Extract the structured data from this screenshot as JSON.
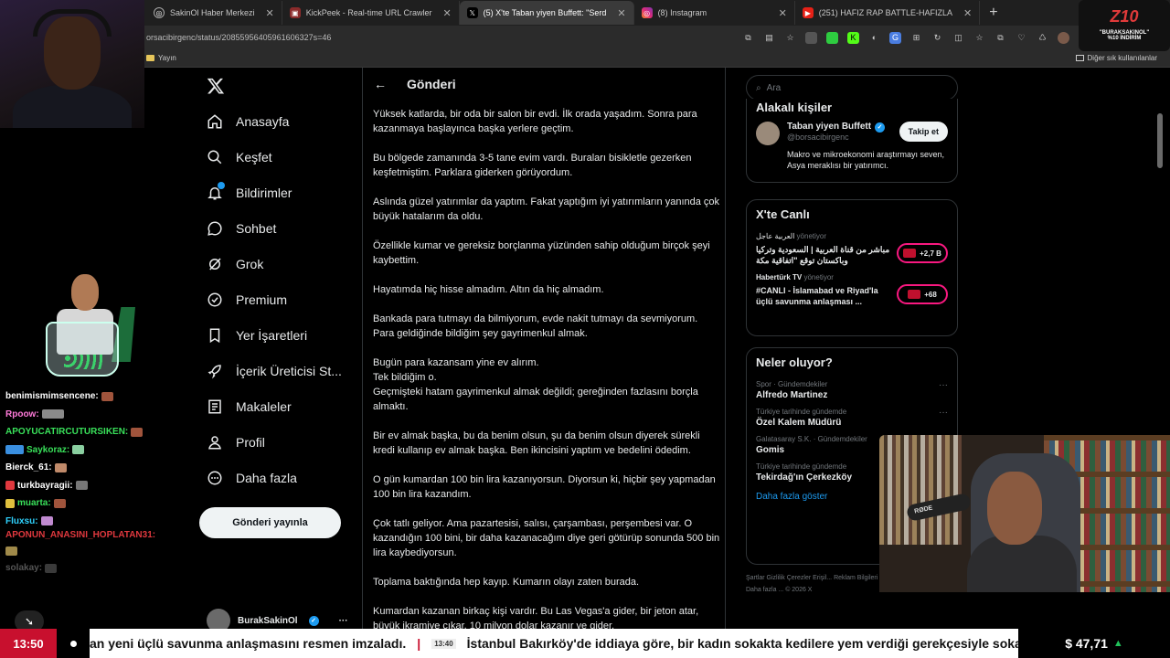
{
  "browser": {
    "tabs": [
      {
        "label": "SakinOl Haber Merkezi",
        "icon": "globe-icon",
        "active": false
      },
      {
        "label": "KickPeek - Real-time URL Crawler",
        "icon": "kickpeek-icon",
        "active": false
      },
      {
        "label": "(5) X'te Taban yiyen Buffett: \"Serd",
        "icon": "x-icon",
        "active": true
      },
      {
        "label": "(8) Instagram",
        "icon": "instagram-icon",
        "active": false
      },
      {
        "label": "(251) HAFIZ RAP BATTLE-HAFIZLA",
        "icon": "youtube-icon",
        "active": false
      }
    ],
    "url": "orsacibirgenc/status/20855956405961606327s=46",
    "bookmark": "Yayın",
    "other_bookmarks": "Diğer sık kullanılanlar"
  },
  "promo": {
    "logo": "Z10",
    "line1": "\"BURAKSAKINOL\"",
    "line2": "%10 İNDİRİM"
  },
  "chat": [
    {
      "user": "benimismimsencene:",
      "color": "#ffffff"
    },
    {
      "user": "Rpoow:",
      "color": "#ff7ad9"
    },
    {
      "user": "APOYUCATIRCUTURSIKEN:",
      "color": "#39e05a"
    },
    {
      "user": "Saykoraz:",
      "color": "#39e05a"
    },
    {
      "user": "Bierck_61:",
      "color": "#ffffff"
    },
    {
      "user": "turkbayragii:",
      "color": "#ffffff"
    },
    {
      "user": "muarta:",
      "color": "#39e05a"
    },
    {
      "user": "Fluxsu:",
      "color": "#2fd3ff"
    },
    {
      "user": "APONUN_ANASINI_HOPLATAN31:",
      "color": "#e0383e"
    },
    {
      "user": "solakay:",
      "color": "#555555"
    }
  ],
  "nav": {
    "items": [
      {
        "label": "Anasayfa",
        "icon": "home-icon"
      },
      {
        "label": "Keşfet",
        "icon": "search-icon"
      },
      {
        "label": "Bildirimler",
        "icon": "bell-icon"
      },
      {
        "label": "Sohbet",
        "icon": "chat-icon"
      },
      {
        "label": "Grok",
        "icon": "grok-icon"
      },
      {
        "label": "Premium",
        "icon": "premium-icon"
      },
      {
        "label": "Yer İşaretleri",
        "icon": "bookmark-icon"
      },
      {
        "label": "İçerik Üreticisi St...",
        "icon": "rocket-icon"
      },
      {
        "label": "Makaleler",
        "icon": "article-icon"
      },
      {
        "label": "Profil",
        "icon": "person-icon"
      },
      {
        "label": "Daha fazla",
        "icon": "more-icon"
      }
    ],
    "post_button": "Gönderi yayınla",
    "account_name": "BurakSakinOl"
  },
  "main": {
    "header": "Gönderi",
    "paragraphs": [
      "Yüksek katlarda, bir oda bir salon bir evdi. İlk orada yaşadım. Sonra para kazanmaya başlayınca başka yerlere geçtim.",
      "Bu bölgede zamanında 3-5 tane evim vardı. Buraları bisikletle gezerken keşfetmiştim. Parklara giderken görüyordum.",
      "Aslında güzel yatırımlar da yaptım. Fakat yaptığım iyi yatırımların yanında çok büyük hatalarım da oldu.",
      "Özellikle kumar ve gereksiz borçlanma yüzünden sahip olduğum birçok şeyi kaybettim.",
      "Hayatımda hiç hisse almadım. Altın da hiç almadım.",
      "Bankada para tutmayı da bilmiyorum, evde nakit tutmayı da sevmiyorum. Para geldiğinde bildiğim şey gayrimenkul almak.",
      "Bugün para kazansam yine ev alırım.\nTek bildiğim o.\nGeçmişteki hatam gayrimenkul almak değildi; gereğinden fazlasını borçla almaktı.",
      "Bir ev almak başka, bu da benim olsun, şu da benim olsun diyerek sürekli kredi kullanıp ev almak başka. Ben ikincisini yaptım ve bedelini ödedim.",
      "O gün kumardan 100 bin lira kazanıyorsun. Diyorsun ki, hiçbir şey yapmadan 100 bin lira kazandım.",
      "Çok tatlı geliyor. Ama pazartesisi, salısı, çarşambası, perşembesi var. O kazandığın 100 bini, bir daha kazanacağım diye geri götürüp sonunda 500 bin lira kaybediyorsun.",
      "Toplama baktığında hep kayıp. Kumarın olayı zaten burada.",
      "Kumardan kazanan birkaç kişi vardır. Bu Las Vegas'a gider, bir jeton atar, büyük ikramiye çıkar, 10 milyon dolar kazanır ve gider."
    ]
  },
  "right": {
    "search_placeholder": "Ara",
    "related_title": "Alakalı kişiler",
    "person": {
      "name": "Taban yiyen Buffett",
      "handle": "@borsacibirgenc",
      "bio": "Makro ve mikroekonomi araştırmayı seven, Asya meraklısı bir yatırımcı.",
      "follow": "Takip et"
    },
    "live_title": "X'te Canlı",
    "live": [
      {
        "source": "العربية عاجل",
        "role": "yönetiyor",
        "title": "مباشر من قناة العربية | السعودية وتركيا وباكستان توقع \"اتفاقية مكة",
        "count": "+2,7 B"
      },
      {
        "source": "Habertürk TV",
        "role": "yönetiyor",
        "title": "#CANLI - İslamabad ve Riyad'la üçlü savunma anlaşması ...",
        "count": "+68"
      }
    ],
    "trends_title": "Neler oluyor?",
    "trends": [
      {
        "category": "Spor · Gündemdekiler",
        "name": "Alfredo Martinez"
      },
      {
        "category": "Türkiye tarihinde gündemde",
        "name": "Özel Kalem Müdürü"
      },
      {
        "category": "Galatasaray S.K. · Gündemdekiler",
        "name": "Gomis"
      },
      {
        "category": "Türkiye tarihinde gündemde",
        "name": "Tekirdağ'ın Çerkezköy"
      }
    ],
    "show_more": "Daha fazla göster",
    "footer": "Şartlar   Gizlilik   Çerezler   Erişil... Reklam Bilgileri   Daha fazla ...   © 2026 X"
  },
  "cam_mic_label": "RØDE",
  "ticker": {
    "time": "13:50",
    "headline1": "an yeni üçlü savunma anlaşmasını resmen imzaladı.",
    "stamp": "13:40",
    "headline2": "İstanbul Bakırköy'de iddiaya göre, bir kadın sokakta kedilere yem verdiği gerekçesiyle sokağa",
    "fx": "$ 47,71"
  },
  "colors": {
    "x_blue": "#1d9bf0",
    "live_pink": "#f91880",
    "ticker_red": "#c8102e"
  }
}
